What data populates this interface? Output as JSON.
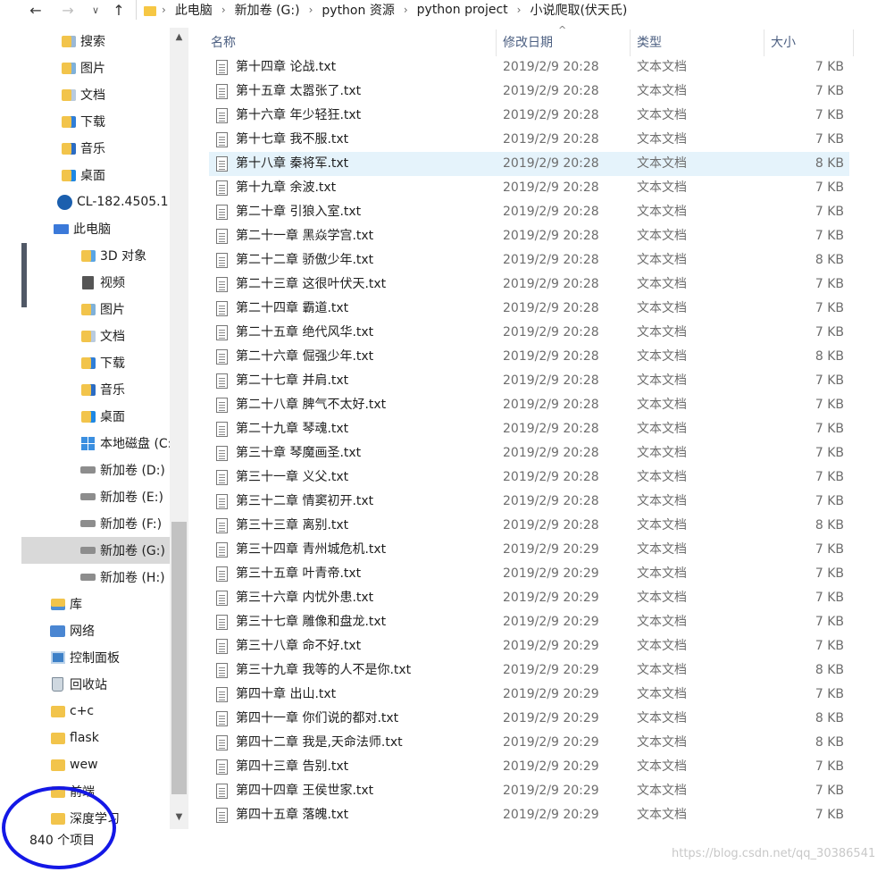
{
  "address": {
    "back": "←",
    "forward": "→",
    "recent": "∨",
    "up": "↑",
    "crumbs": [
      "此电脑",
      "新加卷 (G:)",
      "python 资源",
      "python project",
      "小说爬取(伏天氏)"
    ],
    "separator": "›"
  },
  "sidebar": {
    "scroll_up": "▲",
    "scroll_down": "▼",
    "items": [
      {
        "label": "搜索",
        "icon": "search-icon"
      },
      {
        "label": "图片",
        "icon": "pictures-icon"
      },
      {
        "label": "文档",
        "icon": "documents-icon"
      },
      {
        "label": "下载",
        "icon": "downloads-icon"
      },
      {
        "label": "音乐",
        "icon": "music-icon"
      },
      {
        "label": "桌面",
        "icon": "desktop-icon"
      },
      {
        "label": "CL-182.4505.1",
        "icon": "archive-icon"
      },
      {
        "label": "此电脑",
        "icon": "this-pc-icon"
      },
      {
        "label": "3D 对象",
        "icon": "3d-objects-icon"
      },
      {
        "label": "视频",
        "icon": "videos-icon"
      },
      {
        "label": "图片",
        "icon": "pictures-icon"
      },
      {
        "label": "文档",
        "icon": "documents-icon"
      },
      {
        "label": "下载",
        "icon": "downloads-icon"
      },
      {
        "label": "音乐",
        "icon": "music-icon"
      },
      {
        "label": "桌面",
        "icon": "desktop-icon"
      },
      {
        "label": "本地磁盘 (C:)",
        "icon": "windows-drive-icon"
      },
      {
        "label": "新加卷 (D:)",
        "icon": "drive-icon"
      },
      {
        "label": "新加卷 (E:)",
        "icon": "drive-icon"
      },
      {
        "label": "新加卷 (F:)",
        "icon": "drive-icon"
      },
      {
        "label": "新加卷 (G:)",
        "icon": "drive-icon"
      },
      {
        "label": "新加卷 (H:)",
        "icon": "drive-icon"
      },
      {
        "label": "库",
        "icon": "libraries-icon"
      },
      {
        "label": "网络",
        "icon": "network-icon"
      },
      {
        "label": "控制面板",
        "icon": "control-panel-icon"
      },
      {
        "label": "回收站",
        "icon": "recycle-bin-icon"
      },
      {
        "label": "c+c",
        "icon": "folder-icon"
      },
      {
        "label": "flask",
        "icon": "folder-icon"
      },
      {
        "label": "wew",
        "icon": "folder-icon"
      },
      {
        "label": "前端",
        "icon": "folder-icon"
      },
      {
        "label": "深度学习",
        "icon": "folder-icon"
      }
    ],
    "selected_label": "新加卷 (G:)"
  },
  "columns": {
    "name": "名称",
    "date": "修改日期",
    "type": "类型",
    "size": "大小",
    "sort_indicator": "^"
  },
  "files": [
    {
      "name": "第十四章 论战.txt",
      "date": "2019/2/9 20:28",
      "type": "文本文档",
      "size": "7 KB"
    },
    {
      "name": "第十五章 太嚣张了.txt",
      "date": "2019/2/9 20:28",
      "type": "文本文档",
      "size": "7 KB"
    },
    {
      "name": "第十六章 年少轻狂.txt",
      "date": "2019/2/9 20:28",
      "type": "文本文档",
      "size": "7 KB"
    },
    {
      "name": "第十七章 我不服.txt",
      "date": "2019/2/9 20:28",
      "type": "文本文档",
      "size": "7 KB"
    },
    {
      "name": "第十八章 秦将军.txt",
      "date": "2019/2/9 20:28",
      "type": "文本文档",
      "size": "8 KB"
    },
    {
      "name": "第十九章 余波.txt",
      "date": "2019/2/9 20:28",
      "type": "文本文档",
      "size": "7 KB"
    },
    {
      "name": "第二十章 引狼入室.txt",
      "date": "2019/2/9 20:28",
      "type": "文本文档",
      "size": "7 KB"
    },
    {
      "name": "第二十一章 黑焱学宫.txt",
      "date": "2019/2/9 20:28",
      "type": "文本文档",
      "size": "7 KB"
    },
    {
      "name": "第二十二章 骄傲少年.txt",
      "date": "2019/2/9 20:28",
      "type": "文本文档",
      "size": "8 KB"
    },
    {
      "name": "第二十三章 这很叶伏天.txt",
      "date": "2019/2/9 20:28",
      "type": "文本文档",
      "size": "7 KB"
    },
    {
      "name": "第二十四章 霸道.txt",
      "date": "2019/2/9 20:28",
      "type": "文本文档",
      "size": "7 KB"
    },
    {
      "name": "第二十五章 绝代风华.txt",
      "date": "2019/2/9 20:28",
      "type": "文本文档",
      "size": "7 KB"
    },
    {
      "name": "第二十六章 倔强少年.txt",
      "date": "2019/2/9 20:28",
      "type": "文本文档",
      "size": "8 KB"
    },
    {
      "name": "第二十七章 并肩.txt",
      "date": "2019/2/9 20:28",
      "type": "文本文档",
      "size": "7 KB"
    },
    {
      "name": "第二十八章 脾气不太好.txt",
      "date": "2019/2/9 20:28",
      "type": "文本文档",
      "size": "7 KB"
    },
    {
      "name": "第二十九章 琴魂.txt",
      "date": "2019/2/9 20:28",
      "type": "文本文档",
      "size": "7 KB"
    },
    {
      "name": "第三十章 琴魔画圣.txt",
      "date": "2019/2/9 20:28",
      "type": "文本文档",
      "size": "7 KB"
    },
    {
      "name": "第三十一章 义父.txt",
      "date": "2019/2/9 20:28",
      "type": "文本文档",
      "size": "7 KB"
    },
    {
      "name": "第三十二章 情窦初开.txt",
      "date": "2019/2/9 20:28",
      "type": "文本文档",
      "size": "7 KB"
    },
    {
      "name": "第三十三章 离别.txt",
      "date": "2019/2/9 20:28",
      "type": "文本文档",
      "size": "8 KB"
    },
    {
      "name": "第三十四章 青州城危机.txt",
      "date": "2019/2/9 20:29",
      "type": "文本文档",
      "size": "7 KB"
    },
    {
      "name": "第三十五章 叶青帝.txt",
      "date": "2019/2/9 20:29",
      "type": "文本文档",
      "size": "7 KB"
    },
    {
      "name": "第三十六章 内忧外患.txt",
      "date": "2019/2/9 20:29",
      "type": "文本文档",
      "size": "7 KB"
    },
    {
      "name": "第三十七章 雕像和盘龙.txt",
      "date": "2019/2/9 20:29",
      "type": "文本文档",
      "size": "7 KB"
    },
    {
      "name": "第三十八章 命不好.txt",
      "date": "2019/2/9 20:29",
      "type": "文本文档",
      "size": "7 KB"
    },
    {
      "name": "第三十九章 我等的人不是你.txt",
      "date": "2019/2/9 20:29",
      "type": "文本文档",
      "size": "8 KB"
    },
    {
      "name": "第四十章 出山.txt",
      "date": "2019/2/9 20:29",
      "type": "文本文档",
      "size": "7 KB"
    },
    {
      "name": "第四十一章 你们说的都对.txt",
      "date": "2019/2/9 20:29",
      "type": "文本文档",
      "size": "8 KB"
    },
    {
      "name": "第四十二章 我是,天命法师.txt",
      "date": "2019/2/9 20:29",
      "type": "文本文档",
      "size": "8 KB"
    },
    {
      "name": "第四十三章 告别.txt",
      "date": "2019/2/9 20:29",
      "type": "文本文档",
      "size": "7 KB"
    },
    {
      "name": "第四十四章 王侯世家.txt",
      "date": "2019/2/9 20:29",
      "type": "文本文档",
      "size": "7 KB"
    },
    {
      "name": "第四十五章 落魄.txt",
      "date": "2019/2/9 20:29",
      "type": "文本文档",
      "size": "7 KB"
    }
  ],
  "hovered_file": "第十八章 秦将军.txt",
  "status": {
    "item_count": "840 个项目"
  },
  "watermark": "https://blog.csdn.net/qq_30386541",
  "colors": {
    "annotation_circle": "#1418e6",
    "selection": "#d9d9d9",
    "hover": "#e5f3fb",
    "header_text": "#4d6082"
  }
}
